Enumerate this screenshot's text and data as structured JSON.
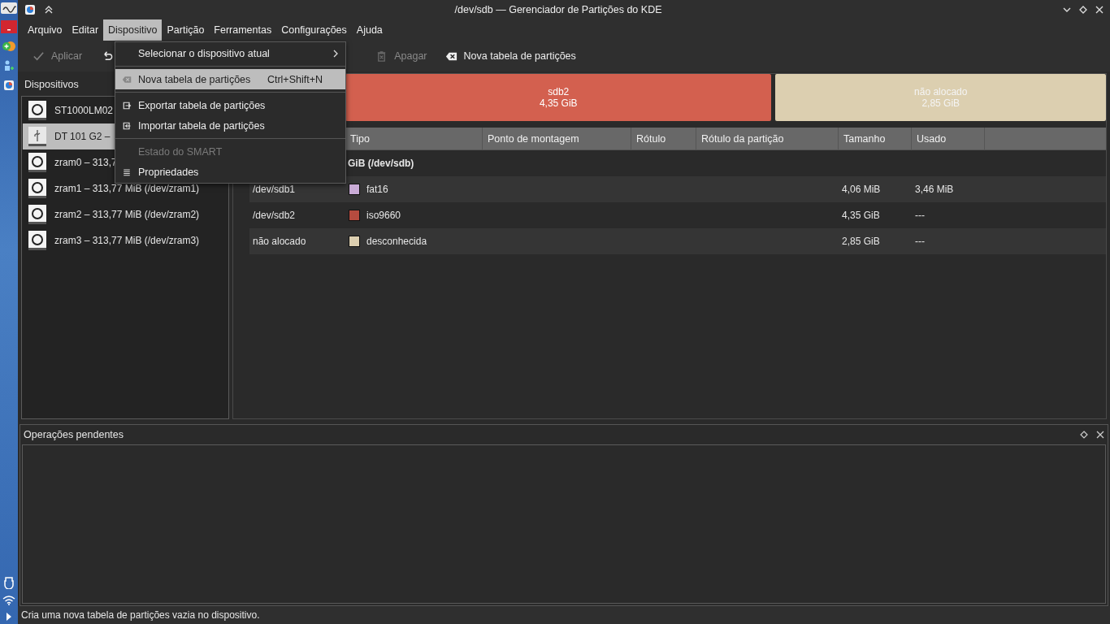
{
  "window": {
    "title": "/dev/sdb — Gerenciador de Partições do KDE"
  },
  "menubar": [
    {
      "label": "Arquivo",
      "selected": false
    },
    {
      "label": "Editar",
      "selected": false
    },
    {
      "label": "Dispositivo",
      "selected": true
    },
    {
      "label": "Partição",
      "selected": false
    },
    {
      "label": "Ferramentas",
      "selected": false
    },
    {
      "label": "Configurações",
      "selected": false
    },
    {
      "label": "Ajuda",
      "selected": false
    }
  ],
  "toolbar": [
    {
      "label": "Aplicar",
      "kind": "apply",
      "disabled": true
    },
    {
      "kind": "undo",
      "disabled": false
    },
    {
      "label": "Apagar",
      "kind": "delete",
      "disabled": true
    },
    {
      "label": "Nova tabela de partições",
      "kind": "new-table",
      "disabled": false
    }
  ],
  "devices": {
    "title": "Dispositivos",
    "items": [
      {
        "label": "ST1000LM02",
        "kind": "disk",
        "selected": false
      },
      {
        "label": "DT 101 G2 –",
        "kind": "usb",
        "selected": true
      },
      {
        "label": "zram0 – 313,7",
        "kind": "disk",
        "selected": false
      },
      {
        "label": "zram1 – 313,77 MiB (/dev/zram1)",
        "kind": "disk",
        "selected": false
      },
      {
        "label": "zram2 – 313,77 MiB (/dev/zram2)",
        "kind": "disk",
        "selected": false
      },
      {
        "label": "zram3 – 313,77 MiB (/dev/zram3)",
        "kind": "disk",
        "selected": false
      }
    ]
  },
  "partition_bar": [
    {
      "label": "sdb2",
      "size": "4,35 GiB",
      "color": "#d3604f",
      "kind": "partition"
    },
    {
      "label": "não alocado",
      "size": "2,85 GiB",
      "color": "#dccfb0",
      "kind": "unallocated"
    }
  ],
  "table": {
    "columns": [
      "Tipo",
      "Ponto de montagem",
      "Rótulo",
      "Rótulo da partição",
      "Tamanho",
      "Usado"
    ],
    "device_row": "GiB (/dev/sdb)",
    "rows": [
      {
        "partition": "/dev/sdb1",
        "type": "fat16",
        "color": "#c9abd6",
        "size": "4,06 MiB",
        "used": "3,46 MiB"
      },
      {
        "partition": "/dev/sdb2",
        "type": "iso9660",
        "color": "#b54b3f",
        "size": "4,35 GiB",
        "used": "---"
      },
      {
        "partition": "não alocado",
        "type": "desconhecida",
        "color": "#dccfb0",
        "size": "2,85 GiB",
        "used": "---"
      }
    ]
  },
  "menu": {
    "groups": [
      [
        {
          "label": "Selecionar o dispositivo atual",
          "kind": "submenu",
          "selected": false,
          "disabled": false
        }
      ],
      [
        {
          "label": "Nova tabela de partições",
          "shortcut": "Ctrl+Shift+N",
          "kind": "new-table",
          "selected": true,
          "disabled": false
        }
      ],
      [
        {
          "label": "Exportar tabela de partições",
          "kind": "export",
          "selected": false,
          "disabled": false
        },
        {
          "label": "Importar tabela de partições",
          "kind": "import",
          "selected": false,
          "disabled": false
        }
      ],
      [
        {
          "label": "Estado do SMART",
          "kind": "plain",
          "selected": false,
          "disabled": true
        },
        {
          "label": "Propriedades",
          "kind": "properties",
          "selected": false,
          "disabled": false
        }
      ]
    ]
  },
  "pending": {
    "title": "Operações pendentes"
  },
  "status_bar": "Cria uma nova tabela de partições vazia no dispositivo."
}
